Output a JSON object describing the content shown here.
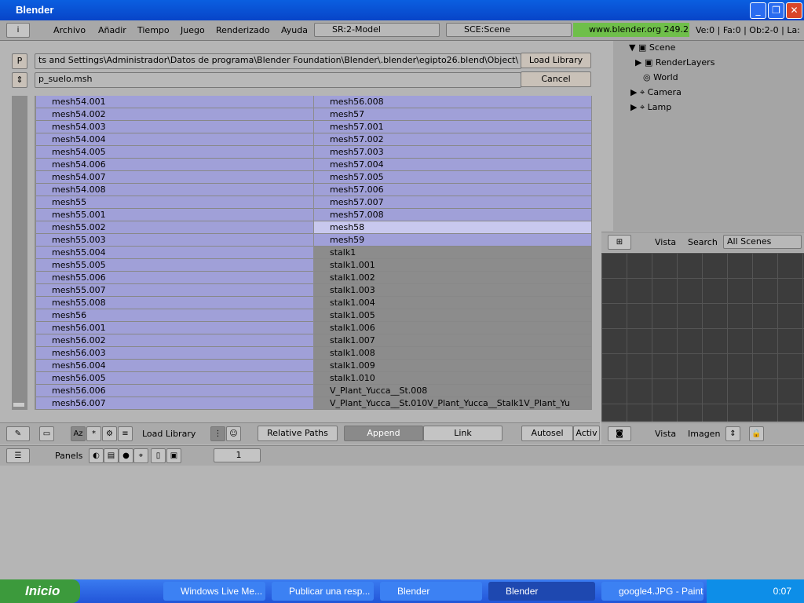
{
  "window": {
    "title": "Blender"
  },
  "menu": {
    "items": [
      "Archivo",
      "Añadir",
      "Tiempo",
      "Juego",
      "Renderizado",
      "Ayuda"
    ],
    "screen": "SR:2-Model",
    "scene": "SCE:Scene",
    "url": "www.blender.org 249.2",
    "stats": "Ve:0 | Fa:0 | Ob:2-0 | La:"
  },
  "file": {
    "p_label": "P",
    "path": "ts and Settings\\Administrador\\Datos de programa\\Blender Foundation\\Blender\\.blender\\egipto26.blend\\Object\\",
    "filename": "p_suelo.msh",
    "load_label": "Load Library",
    "cancel_label": "Cancel"
  },
  "list": {
    "left": [
      "mesh54.001",
      "mesh54.002",
      "mesh54.003",
      "mesh54.004",
      "mesh54.005",
      "mesh54.006",
      "mesh54.007",
      "mesh54.008",
      "mesh55",
      "mesh55.001",
      "mesh55.002",
      "mesh55.003",
      "mesh55.004",
      "mesh55.005",
      "mesh55.006",
      "mesh55.007",
      "mesh55.008",
      "mesh56",
      "mesh56.001",
      "mesh56.002",
      "mesh56.003",
      "mesh56.004",
      "mesh56.005",
      "mesh56.006",
      "mesh56.007"
    ],
    "right": [
      "mesh56.008",
      "mesh57",
      "mesh57.001",
      "mesh57.002",
      "mesh57.003",
      "mesh57.004",
      "mesh57.005",
      "mesh57.006",
      "mesh57.007",
      "mesh57.008",
      "mesh58",
      "mesh59",
      "stalk1",
      "stalk1.001",
      "stalk1.002",
      "stalk1.003",
      "stalk1.004",
      "stalk1.005",
      "stalk1.006",
      "stalk1.007",
      "stalk1.008",
      "stalk1.009",
      "stalk1.010",
      "V_Plant_Yucca__St.008",
      "V_Plant_Yucca__St.010V_Plant_Yucca__Stalk1V_Plant_Yu"
    ],
    "right_selected_count": 12,
    "hover": "mesh58"
  },
  "filebar": {
    "load_library": "Load Library",
    "relative_paths": "Relative Paths",
    "append": "Append",
    "link": "Link",
    "autosel": "Autosel",
    "active": "Activ"
  },
  "outliner": {
    "items": [
      "Scene",
      "RenderLayers",
      "World",
      "Camera",
      "Lamp"
    ],
    "vista": "Vista",
    "search": "Search",
    "scenes": "All Scenes"
  },
  "image": {
    "vista": "Vista",
    "imagen": "Imagen"
  },
  "buttons": {
    "panels": "Panels",
    "frame": "1"
  },
  "taskbar": {
    "start": "Inicio",
    "tasks": [
      "Windows Live Me...",
      "Publicar una resp...",
      "Blender",
      "Blender",
      "google4.JPG - Paint"
    ],
    "clock": "0:07"
  }
}
